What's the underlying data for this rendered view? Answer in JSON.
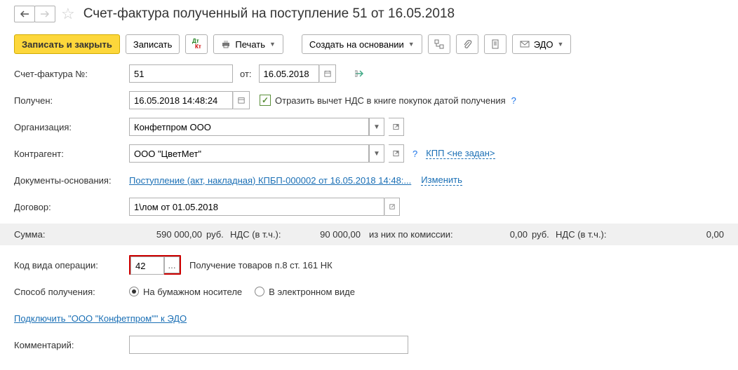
{
  "title": "Счет-фактура полученный на поступление 51 от 16.05.2018",
  "toolbar": {
    "save_close": "Записать и закрыть",
    "save": "Записать",
    "print": "Печать",
    "create_based": "Создать на основании",
    "edo": "ЭДО"
  },
  "fields": {
    "invoice_no_label": "Счет-фактура №:",
    "invoice_no": "51",
    "from_label": "от:",
    "invoice_date": "16.05.2018",
    "received_label": "Получен:",
    "received": "16.05.2018 14:48:24",
    "vat_checkbox": "Отразить вычет НДС в книге покупок датой получения",
    "org_label": "Организация:",
    "org": "Конфетпром ООО",
    "counterparty_label": "Контрагент:",
    "counterparty": "ООО \"ЦветМет\"",
    "kpp": "КПП <не задан>",
    "basis_label": "Документы-основания:",
    "basis_link": "Поступление (акт, накладная) КПБП-000002 от 16.05.2018 14:48:...",
    "change": "Изменить",
    "contract_label": "Договор:",
    "contract": "1\\лом от 01.05.2018",
    "op_code_label": "Код вида операции:",
    "op_code": "42",
    "op_code_desc": "Получение товаров п.8 ст. 161 НК",
    "receive_mode_label": "Способ получения:",
    "mode_paper": "На бумажном носителе",
    "mode_electronic": "В электронном виде",
    "connect_edo": "Подключить \"ООО \"Конфетпром\"\" к ЭДО",
    "comment_label": "Комментарий:"
  },
  "totals": {
    "sum_label": "Сумма:",
    "sum": "590 000,00",
    "currency": "руб.",
    "vat_label": "НДС (в т.ч.):",
    "vat": "90 000,00",
    "commission_label": "из них по комиссии:",
    "commission": "0,00",
    "vat2_label": "НДС (в т.ч.):",
    "vat2": "0,00"
  }
}
